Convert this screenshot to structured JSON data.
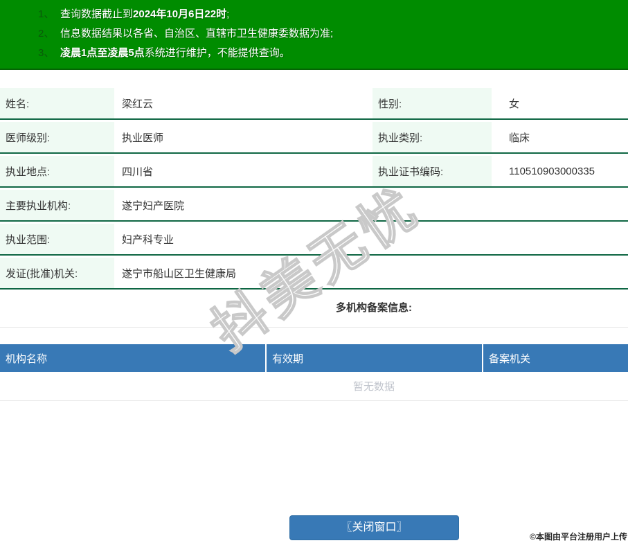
{
  "notice_banner": {
    "bg_color": "#008c00",
    "items": [
      {
        "num": "1、",
        "pre": "查询数据截止到",
        "bold": "2024年10月6日22时",
        "post": ";"
      },
      {
        "num": "2、",
        "pre": "信息数据结果以各省、自治区、直辖市卫生健康委数据为准;",
        "bold": "",
        "post": ""
      },
      {
        "num": "3、",
        "pre": "",
        "bold": "凌晨1点至凌晨5点",
        "post": "系统进行维护，不能提供查询。"
      }
    ]
  },
  "info_table": {
    "label_bg": "#effaf3",
    "row_border_color": "#0e6643",
    "rows": [
      {
        "cells": [
          {
            "label": "姓名:",
            "value": "梁红云"
          },
          {
            "label": "性别:",
            "value": "女"
          }
        ]
      },
      {
        "cells": [
          {
            "label": "医师级别:",
            "value": "执业医师"
          },
          {
            "label": "执业类别:",
            "value": "临床"
          }
        ]
      },
      {
        "cells": [
          {
            "label": "执业地点:",
            "value": "四川省"
          },
          {
            "label": "执业证书编码:",
            "value": "110510903000335"
          }
        ]
      },
      {
        "cells": [
          {
            "label": "主要执业机构:",
            "value": "遂宁妇产医院"
          }
        ]
      },
      {
        "cells": [
          {
            "label": "执业范围:",
            "value": "妇产科专业"
          }
        ]
      },
      {
        "cells": [
          {
            "label": "发证(批准)机关:",
            "value": "遂宁市船山区卫生健康局"
          }
        ]
      }
    ]
  },
  "filing_section": {
    "title": "多机构备案信息:",
    "header_bg": "#3879b6",
    "columns": [
      "机构名称",
      "有效期",
      "备案机关"
    ],
    "empty_text": "暂无数据"
  },
  "watermark": {
    "text": "抖美无忧"
  },
  "close_button": {
    "label": "〖关闭窗口〗"
  },
  "footer": {
    "credit": "©本图由平台注册用户上传"
  }
}
